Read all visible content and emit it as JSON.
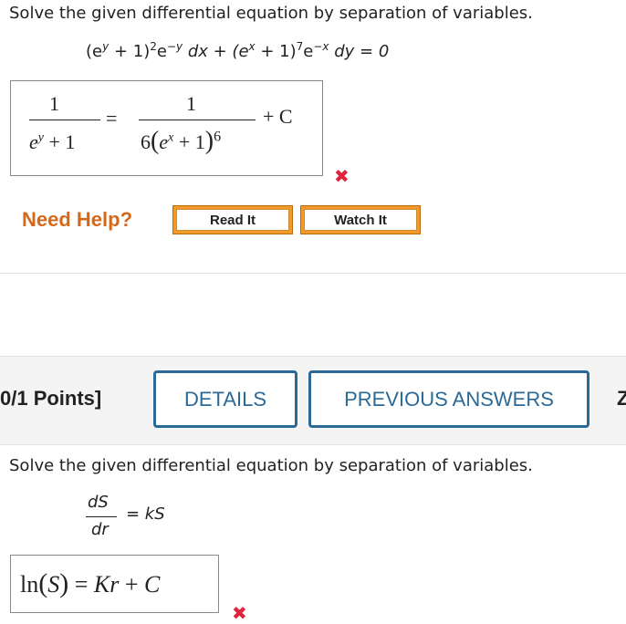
{
  "q1": {
    "prompt": "Solve the given differential equation by separation of variables.",
    "equation": {
      "a": "(e",
      "a_sup": "y",
      "b": " + 1)",
      "b_sup": "2",
      "c": "e",
      "c_sup": "−y",
      "d": " dx + (e",
      "d_sup": "x",
      "e": " + 1)",
      "e_sup": "7",
      "f": "e",
      "f_sup": "−x",
      "g": " dy = 0"
    },
    "answer": {
      "left_num": "1",
      "left_den_base": "e",
      "left_den_sup": "y",
      "left_den_rest": "+ 1",
      "equals": "=",
      "right_num": "1",
      "right_den_coef": "6",
      "right_den_open": "(",
      "right_den_base": "e",
      "right_den_sup": "x",
      "right_den_rest": "+ 1",
      "right_den_close": ")",
      "right_den_pow": "6",
      "plus_c": "+ C"
    },
    "result_mark": "✖"
  },
  "help": {
    "label": "Need Help?",
    "read_it": "Read It",
    "watch_it": "Watch It"
  },
  "q2_header": {
    "points": "0/1 Points]",
    "details": "DETAILS",
    "previous_answers": "PREVIOUS ANSWERS",
    "cut_off": "Z"
  },
  "q2": {
    "prompt": "Solve the given differential equation by separation of variables.",
    "dS": "dS",
    "dr": "dr",
    "rhs": "= kS",
    "answer": {
      "ln": "ln",
      "open": "(",
      "S": "S",
      "close": ")",
      "equals": "=",
      "Kr": "Kr",
      "plus": "+",
      "C": "C"
    },
    "result_mark": "✖"
  }
}
